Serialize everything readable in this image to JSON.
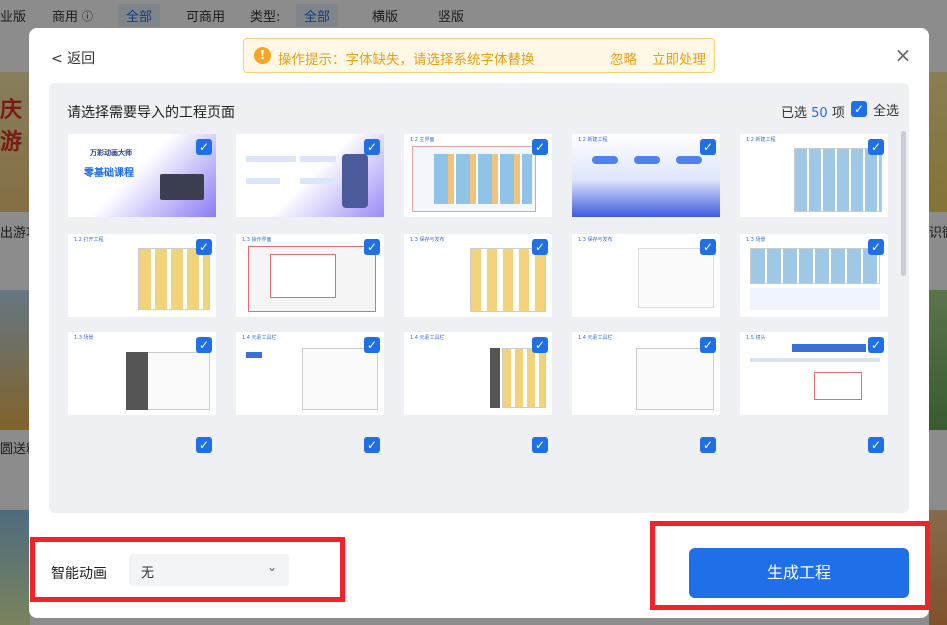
{
  "background": {
    "filters": {
      "left_text": "业版",
      "usage_label": "商用",
      "usage_options": [
        "全部",
        "可商用"
      ],
      "type_label": "类型:",
      "type_options": [
        "全部",
        "横版",
        "竖版"
      ]
    },
    "left_labels": [
      "出游功",
      "圆送粉"
    ],
    "right_labels": [
      "识微"
    ],
    "banner_chars": [
      "庆",
      "游"
    ]
  },
  "modal": {
    "back_label": "< 返回",
    "tip": {
      "icon": "!",
      "text": "操作提示：字体缺失，请选择系统字体替换",
      "ignore": "忽略",
      "fix": "立即处理"
    },
    "close_icon": "×",
    "panel": {
      "title": "请选择需要导入的工程页面",
      "selected_prefix": "已选",
      "selected_count": "50",
      "selected_suffix": "项",
      "select_all_label": "全选",
      "check_mark": "✓",
      "slides": [
        {
          "title": "万彩动画大师",
          "subtitle": "零基础课程"
        },
        {
          "title": "",
          "subtitle": ""
        },
        {
          "title": "1.2 主界面",
          "subtitle": ""
        },
        {
          "title": "1.2 新建工程",
          "subtitle": ""
        },
        {
          "title": "1.2 新建工程",
          "subtitle": ""
        },
        {
          "title": "1.2 打开工程",
          "subtitle": ""
        },
        {
          "title": "1.3 操作界面",
          "subtitle": ""
        },
        {
          "title": "1.3 保存与发布",
          "subtitle": ""
        },
        {
          "title": "1.3 保存与发布",
          "subtitle": ""
        },
        {
          "title": "1.3 场景",
          "subtitle": ""
        },
        {
          "title": "1.3 场景",
          "subtitle": ""
        },
        {
          "title": "1.4 元素工具栏",
          "subtitle": ""
        },
        {
          "title": "1.4 元素工具栏",
          "subtitle": ""
        },
        {
          "title": "1.4 元素工具栏",
          "subtitle": ""
        },
        {
          "title": "1.5 镜头",
          "subtitle": ""
        }
      ]
    },
    "animation": {
      "label": "智能动画",
      "value": "无",
      "chevron_icon": "⌄"
    },
    "generate_label": "生成工程"
  }
}
